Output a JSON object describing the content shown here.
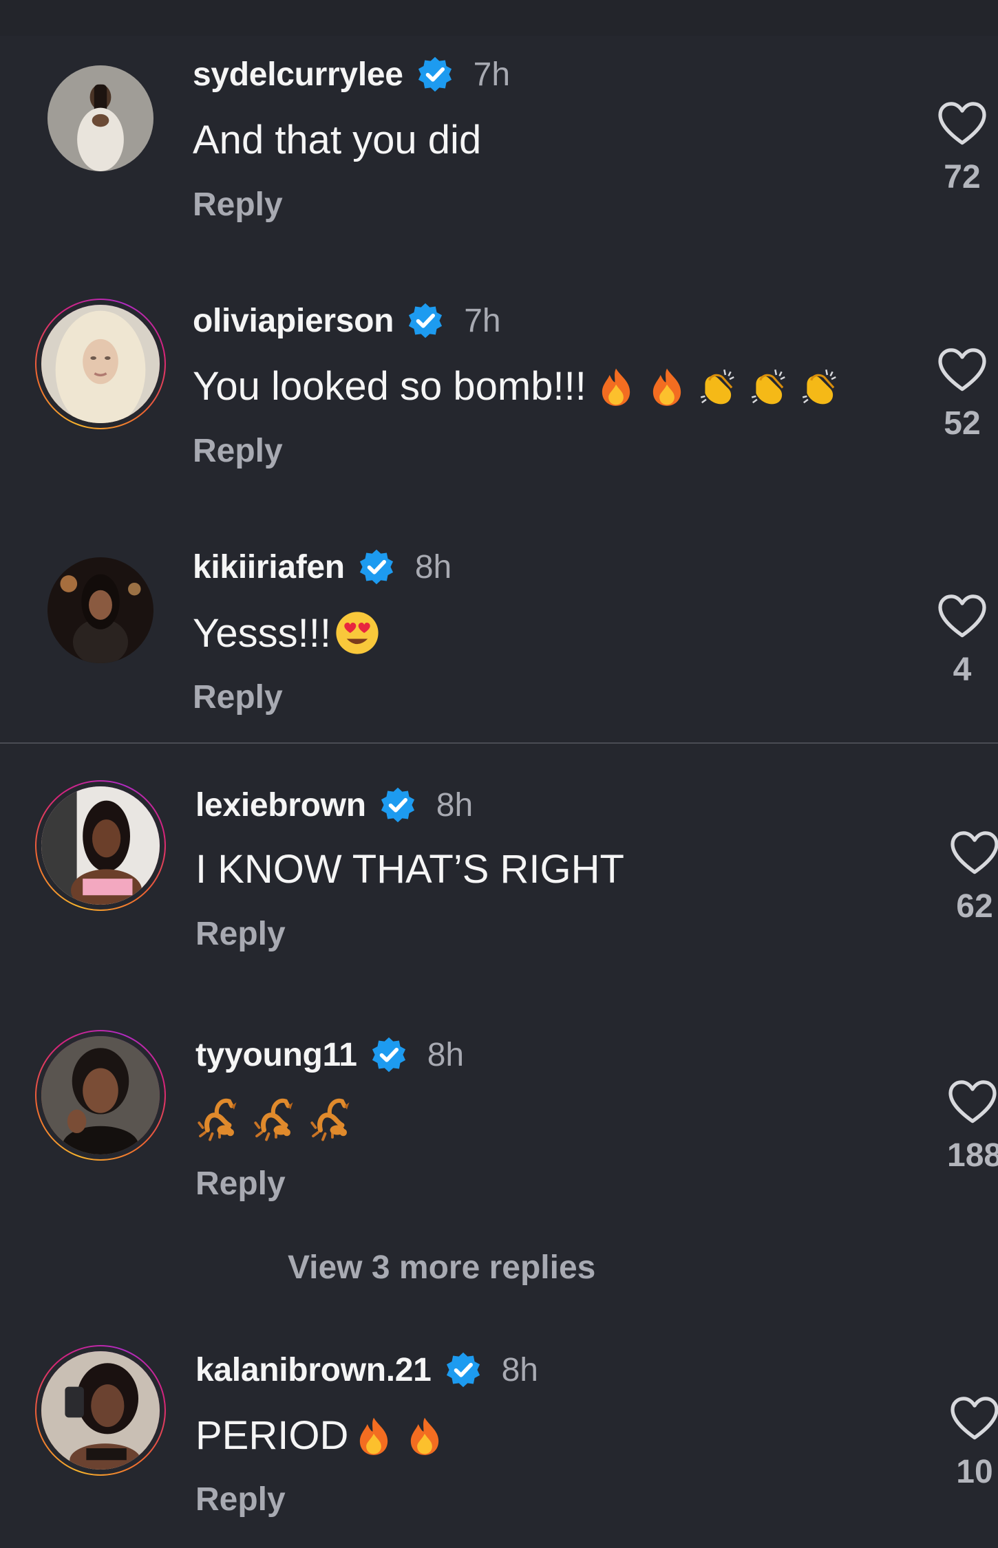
{
  "comments": [
    {
      "username": "sydelcurrylee",
      "time": "7h",
      "text": "And that you did",
      "reply": "Reply",
      "likes": "72",
      "emojis": [],
      "ring": false
    },
    {
      "username": "oliviapierson",
      "time": "7h",
      "text": "You looked so bomb!!!",
      "reply": "Reply",
      "likes": "52",
      "emojis": [
        "fire-emoji",
        "fire-emoji",
        "clapping-hands-emoji",
        "clapping-hands-emoji",
        "clapping-hands-emoji"
      ],
      "ring": true
    },
    {
      "username": "kikiiriafen",
      "time": "8h",
      "text": "Yesss!!!",
      "reply": "Reply",
      "likes": "4",
      "emojis": [
        "heart-eyes-emoji"
      ],
      "ring": false
    },
    {
      "username": "lexiebrown",
      "time": "8h",
      "text": "I KNOW THAT’S RIGHT",
      "reply": "Reply",
      "likes": "62",
      "emojis": [],
      "ring": true
    },
    {
      "username": "tyyoung11",
      "time": "8h",
      "text": "",
      "reply": "Reply",
      "likes": "188",
      "emojis": [
        "scorpion-emoji",
        "scorpion-emoji",
        "scorpion-emoji"
      ],
      "ring": true
    },
    {
      "username": "kalanibrown.21",
      "time": "8h",
      "text": "PERIOD",
      "reply": "Reply",
      "likes": "10",
      "emojis": [
        "fire-emoji",
        "fire-emoji"
      ],
      "ring": true
    }
  ],
  "view_more_replies": "View 3 more replies",
  "colors": {
    "background": "#25272e",
    "verified_badge": "#1d9bf0",
    "muted_text": "#a8aab2",
    "story_ring": [
      "#f8b42c",
      "#f0682f",
      "#d6237a",
      "#b12bc4"
    ]
  }
}
